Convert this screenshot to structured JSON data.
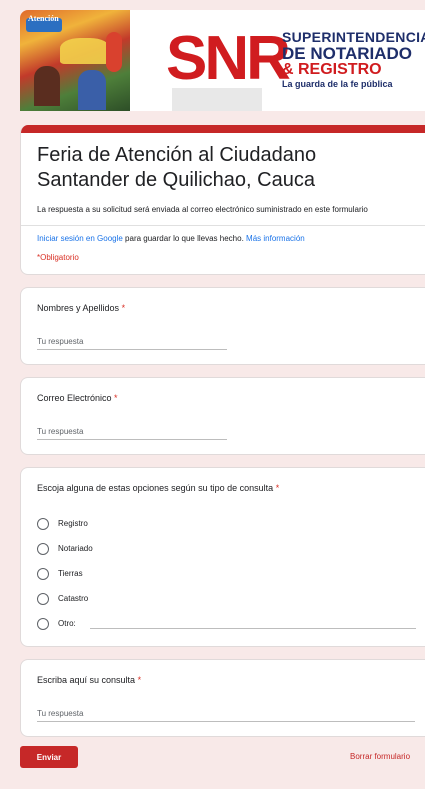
{
  "header": {
    "banner_tag": "Atención",
    "logo_letters": "SNR",
    "org_line1": "SUPERINTENDENCIA",
    "org_line2": "DE NOTARIADO",
    "org_line3": "& REGISTRO",
    "org_tagline": "La guarda de la fe pública"
  },
  "form": {
    "title_line1": "Feria de Atención al Ciudadano",
    "title_line2": "Santander de Quilichao, Cauca",
    "description": "La respuesta a su solicitud será enviada al correo electrónico suministrado en este formulario",
    "signin_link": "Iniciar sesión en Google",
    "signin_text": " para guardar lo que llevas hecho. ",
    "more_info_link": "Más información",
    "required_note": "*Obligatorio"
  },
  "questions": {
    "name": {
      "label": "Nombres y Apellidos",
      "required_mark": "*",
      "placeholder": "Tu respuesta"
    },
    "email": {
      "label": "Correo Electrónico",
      "required_mark": "*",
      "placeholder": "Tu respuesta"
    },
    "query_type": {
      "label": "Escoja alguna de estas opciones según su tipo de consulta",
      "required_mark": "*",
      "options": [
        "Registro",
        "Notariado",
        "Tierras",
        "Catastro",
        "Otro:"
      ]
    },
    "query": {
      "label": "Escriba aquí su consulta",
      "required_mark": "*",
      "placeholder": "Tu respuesta"
    }
  },
  "footer": {
    "submit_label": "Enviar",
    "clear_label": "Borrar formulario"
  },
  "colors": {
    "accent": "#c62828",
    "background": "#f8e9e8",
    "link": "#1a73e8",
    "required": "#d93025"
  }
}
